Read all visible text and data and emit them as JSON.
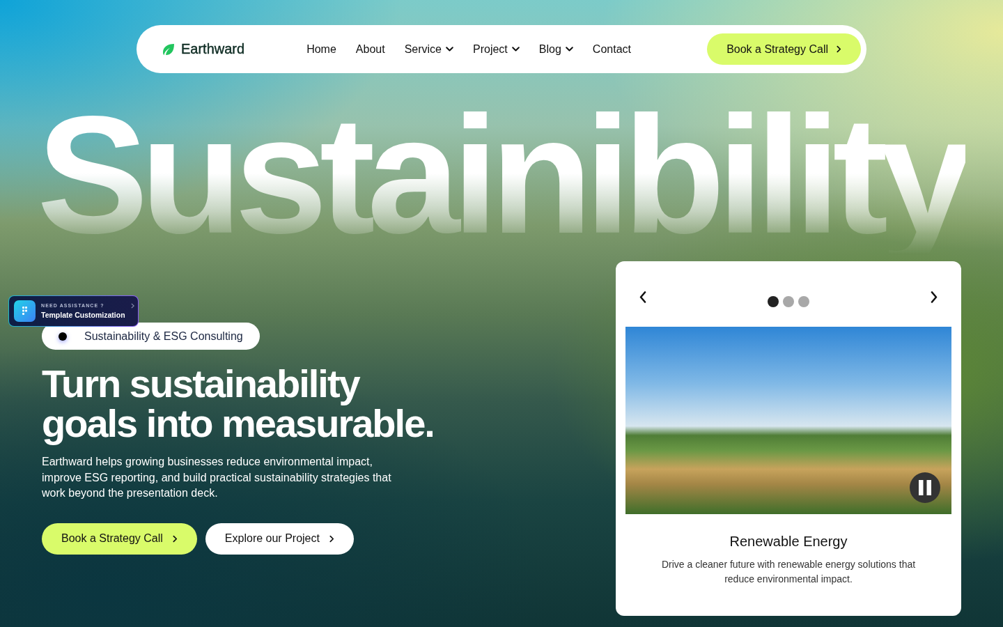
{
  "nav": {
    "brand": "Earthward",
    "links": [
      {
        "label": "Home",
        "has_menu": false
      },
      {
        "label": "About",
        "has_menu": false
      },
      {
        "label": "Service",
        "has_menu": true
      },
      {
        "label": "Project",
        "has_menu": true
      },
      {
        "label": "Blog",
        "has_menu": true
      },
      {
        "label": "Contact",
        "has_menu": false
      }
    ],
    "cta": "Book a Strategy Call"
  },
  "hero": {
    "display_word": "Sustainibility",
    "badge": "Sustainability & ESG Consulting",
    "heading": "Turn sustainability goals into measurable.",
    "description": "Earthward helps growing businesses reduce environmental impact, improve ESG reporting, and build practical sustainability strategies that work beyond the presentation deck.",
    "buttons": [
      {
        "label": "Book a Strategy Call",
        "kind": "primary"
      },
      {
        "label": "Explore our Project",
        "kind": "secondary"
      }
    ]
  },
  "help_widget": {
    "eyebrow": "NEED ASSISTANCE ?",
    "title": "Template Customization"
  },
  "carousel": {
    "dots": [
      {
        "selected": true
      },
      {
        "selected": false
      },
      {
        "selected": false
      }
    ],
    "playing": true,
    "slide": {
      "title": "Renewable Energy",
      "text": "Drive a cleaner future with renewable energy solutions that reduce environmental impact."
    }
  }
}
